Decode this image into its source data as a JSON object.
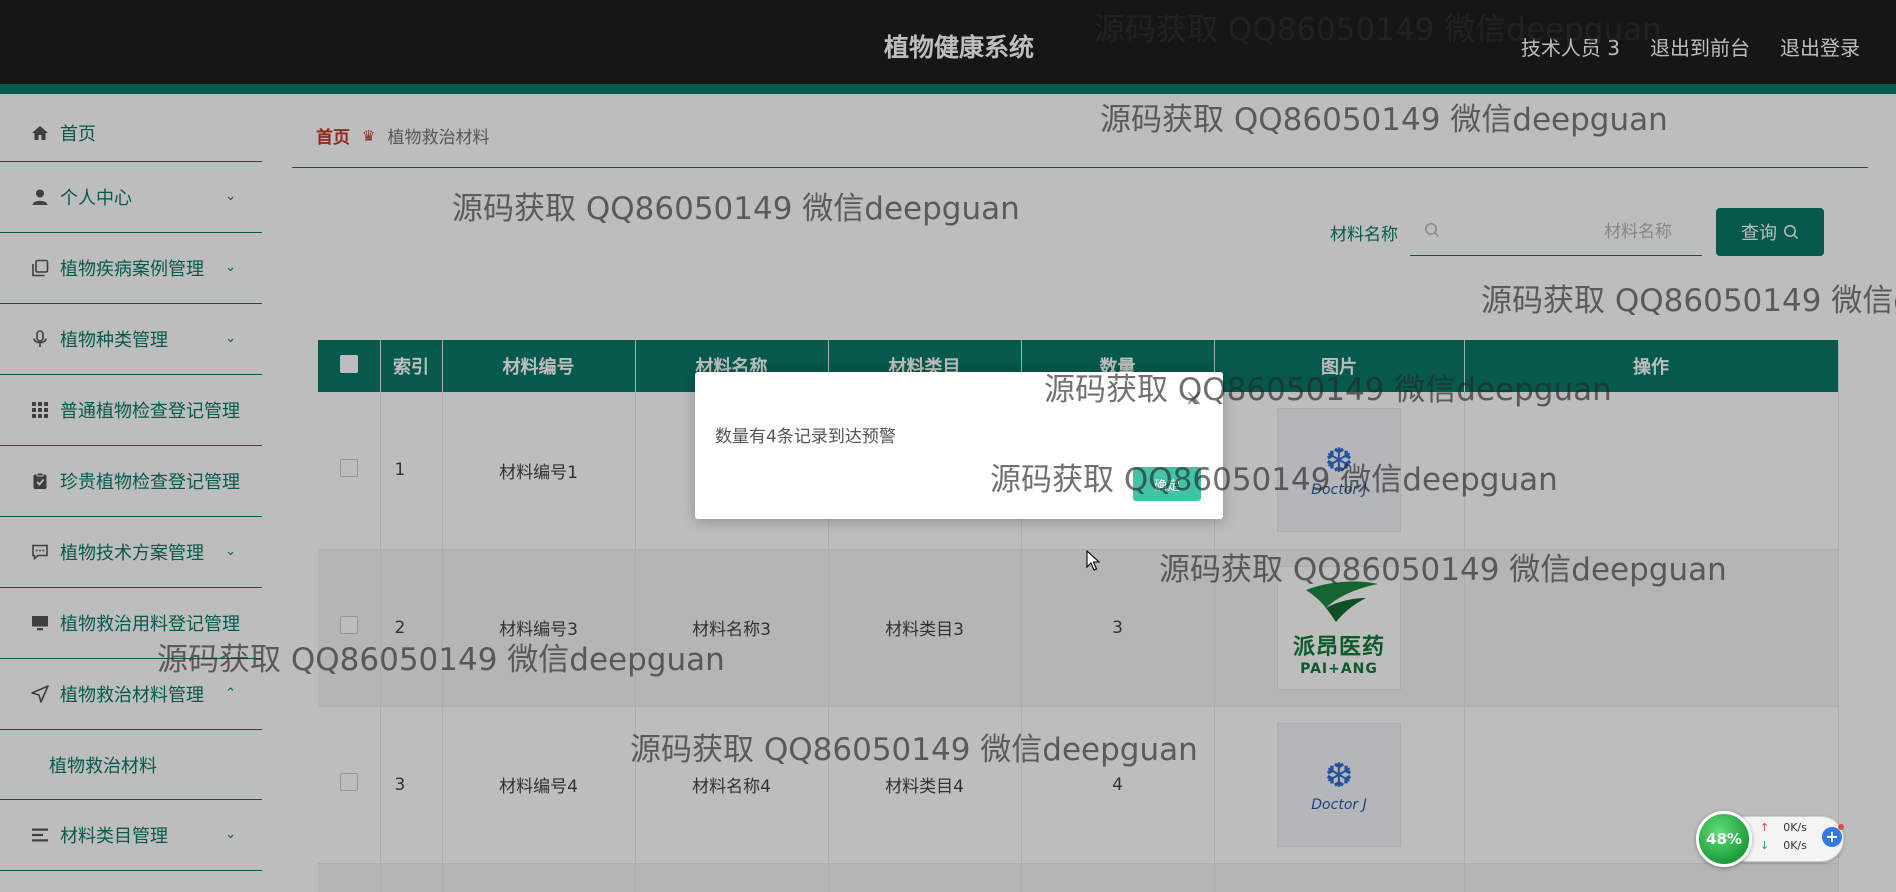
{
  "header": {
    "title": "植物健康系统",
    "nav": [
      "技术人员 3",
      "退出到前台",
      "退出登录"
    ]
  },
  "sidebar": {
    "items": [
      {
        "label": "首页",
        "icon": "home-icon"
      },
      {
        "label": "个人中心",
        "icon": "user-icon"
      },
      {
        "label": "植物疾病案例管理",
        "icon": "copy-icon"
      },
      {
        "label": "植物种类管理",
        "icon": "microphone-icon"
      },
      {
        "label": "普通植物检查登记管理",
        "icon": "grid-icon"
      },
      {
        "label": "珍贵植物检查登记管理",
        "icon": "clipboard-icon"
      },
      {
        "label": "植物技术方案管理",
        "icon": "chat-icon"
      },
      {
        "label": "植物救治用料登记管理",
        "icon": "monitor-icon"
      },
      {
        "label": "植物救治材料管理",
        "icon": "send-icon"
      },
      {
        "label": "材料类目管理",
        "icon": "list-icon"
      }
    ],
    "submenu_item": "植物救治材料"
  },
  "breadcrumb": {
    "home": "首页",
    "current": "植物救治材料"
  },
  "search": {
    "label": "材料名称",
    "placeholder": "材料名称",
    "button": "查询"
  },
  "table": {
    "headers": [
      "索引",
      "材料编号",
      "材料名称",
      "材料类目",
      "数量",
      "图片",
      "操作"
    ],
    "rows": [
      {
        "index": "1",
        "code": "材料编号1",
        "name": "",
        "category": "",
        "qty": "",
        "image": "doctor-j"
      },
      {
        "index": "2",
        "code": "材料编号3",
        "name": "材料名称3",
        "category": "材料类目3",
        "qty": "3",
        "image": "paiang"
      },
      {
        "index": "3",
        "code": "材料编号4",
        "name": "材料名称4",
        "category": "材料类目4",
        "qty": "4",
        "image": "doctor-j"
      }
    ],
    "logos": {
      "doctor_j": "Doctor J",
      "paiang_cn": "派昂医药",
      "paiang_en": "PAI+ANG"
    }
  },
  "dialog": {
    "message": "数量有4条记录到达预警",
    "ok": "确定",
    "close": "×"
  },
  "watermark": "源码获取 QQ86050149 微信deepguan",
  "netwidget": {
    "percent": "48%",
    "up": "0K/s",
    "down": "0K/s"
  },
  "colors": {
    "primary": "#087a68",
    "header_bg": "#1e1e1e",
    "accent": "#3fc4a6",
    "breadcrumb_home": "#c0392b"
  }
}
